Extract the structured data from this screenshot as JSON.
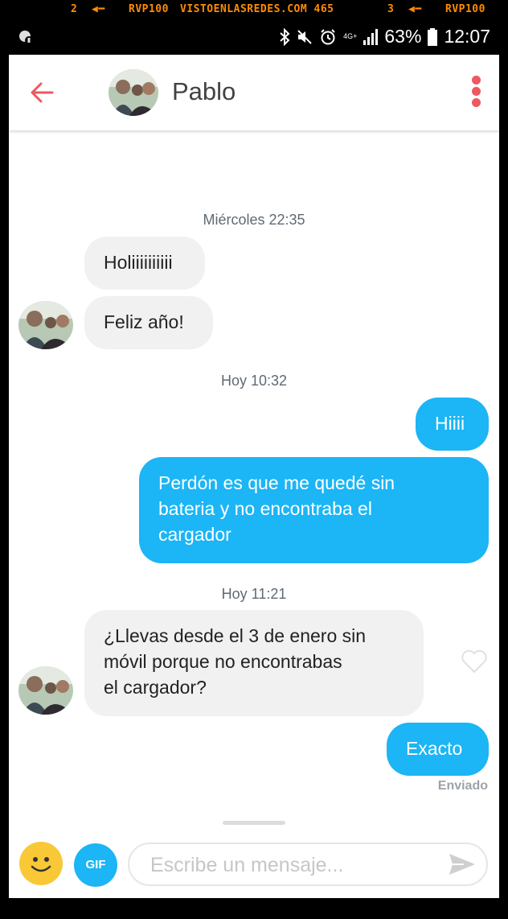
{
  "ticker": {
    "items": [
      "2",
      "RVP100",
      "VISTOENLASREDES.COM 465",
      "3",
      "RVP100"
    ]
  },
  "status_bar": {
    "network": "4G+",
    "battery": "63%",
    "time": "12:07"
  },
  "header": {
    "contact_name": "Pablo"
  },
  "messages": [
    {
      "type": "timestamp",
      "text": "Miércoles 22:35"
    },
    {
      "type": "in",
      "text": "Holiiiiiiiiii"
    },
    {
      "type": "in",
      "text": "Feliz año!"
    },
    {
      "type": "timestamp",
      "text": "Hoy 10:32"
    },
    {
      "type": "out",
      "text": "Hiiii"
    },
    {
      "type": "out",
      "lines": [
        "Perdón es que me quedé sin",
        "bateria y no encontraba el",
        "cargador"
      ]
    },
    {
      "type": "timestamp",
      "text": "Hoy 11:21"
    },
    {
      "type": "in",
      "lines": [
        "¿Llevas desde el 3 de enero sin",
        "móvil porque no encontrabas",
        "el cargador?"
      ]
    },
    {
      "type": "out",
      "text": "Exacto"
    }
  ],
  "delivery_status": "Enviado",
  "composer": {
    "gif_label": "GIF",
    "placeholder": "Escribe un mensaje..."
  },
  "colors": {
    "accent_red": "#ef5761",
    "outgoing_bubble": "#1cb5f5",
    "incoming_bubble": "#f1f1f1"
  },
  "icons": [
    "back-arrow-icon",
    "more-vertical-icon",
    "heart-icon",
    "emoji-icon",
    "send-icon",
    "bluetooth-icon",
    "mute-icon",
    "alarm-icon",
    "signal-icon",
    "battery-icon"
  ]
}
